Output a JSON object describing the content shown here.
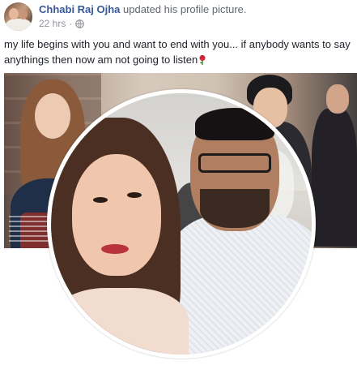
{
  "post": {
    "author": "Chhabi Raj Ojha",
    "action": "updated his profile picture.",
    "time": "22 hrs",
    "separator": "·",
    "privacy_icon": "globe-icon",
    "caption": "my life begins with you and want to end with you... if anybody wants to say anythings then now am not going to listen",
    "caption_emoji": "rose-icon"
  },
  "colors": {
    "author_link": "#385898",
    "meta_text": "#90949c",
    "body_text": "#1d2129"
  }
}
